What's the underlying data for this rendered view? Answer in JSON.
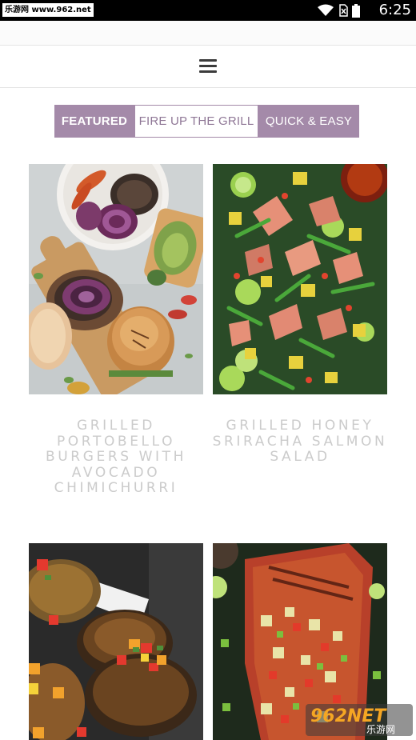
{
  "status_bar": {
    "badge": "乐游网 www.962.net",
    "time": "6:25",
    "icons": [
      "wifi-icon",
      "no-sim-icon",
      "battery-icon"
    ]
  },
  "header": {
    "menu_icon": "hamburger-menu-icon"
  },
  "tabs": [
    {
      "label": "FEATURED",
      "active": true
    },
    {
      "label": "FIRE UP THE GRILL",
      "active": false
    },
    {
      "label": "QUICK & EASY",
      "active": false
    }
  ],
  "recipes": [
    {
      "title": "GRILLED PORTOBELLO BURGERS WITH AVOCADO CHIMICHURRI",
      "image": "portobello-burger-photo"
    },
    {
      "title": "GRILLED HONEY SRIRACHA SALMON SALAD",
      "image": "salmon-salad-photo"
    },
    {
      "title": "",
      "image": "chicken-salsa-photo"
    },
    {
      "title": "",
      "image": "grilled-salmon-salsa-photo"
    }
  ],
  "watermark": {
    "main": "962NET",
    "sub": "乐游网"
  },
  "colors": {
    "tab_accent": "#a48aa9",
    "title_text": "#cbcbcb",
    "status_bar": "#000000"
  }
}
